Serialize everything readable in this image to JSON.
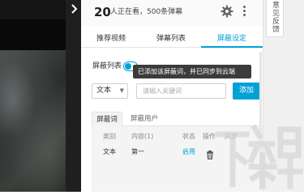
{
  "video": {
    "collapse_icon": "chevron-right-icon"
  },
  "header": {
    "online_count": "20",
    "online_suffix": "人正在看，500条弹幕",
    "settings_icon": "gear-icon",
    "more_icon": "more-vertical-icon"
  },
  "feedback": {
    "label": "意见反馈"
  },
  "tabs": [
    {
      "label": "推荐视频",
      "active": false
    },
    {
      "label": "弹幕列表",
      "active": false
    },
    {
      "label": "屏蔽设定",
      "active": true
    }
  ],
  "block": {
    "label": "屏蔽列表",
    "toggle_on": true,
    "tooltip": "已添加该屏蔽词，并已同步到云端",
    "type_value": "文本",
    "input_placeholder": "请输入关键词",
    "add_label": "添加"
  },
  "sub_tabs": [
    {
      "label": "屏蔽词",
      "active": true
    },
    {
      "label": "屏蔽用户",
      "active": false
    }
  ],
  "table": {
    "headers": [
      "类别",
      "内容(1)",
      "状态",
      "操作",
      "同步"
    ],
    "rows": [
      {
        "type": "文本",
        "content": "第一",
        "status": "启用",
        "action_icon": "trash-icon",
        "sync": ""
      }
    ]
  },
  "colors": {
    "accent": "#00a1d6",
    "tooltip_bg": "#3b3b3b",
    "video_bg": "#090909"
  },
  "watermark": {
    "text": "下载吧"
  }
}
